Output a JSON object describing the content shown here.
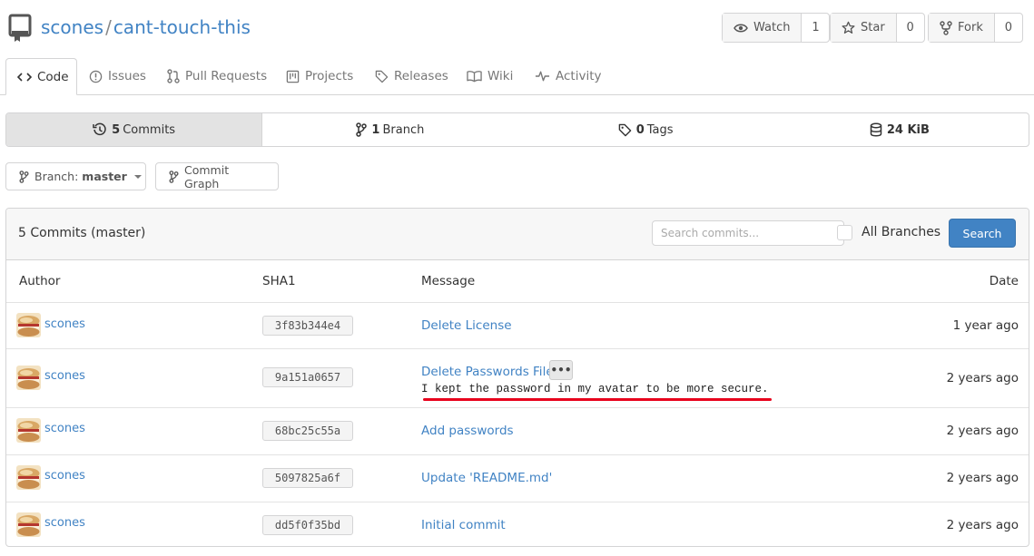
{
  "repo": {
    "owner": "scones",
    "name": "cant-touch-this",
    "separator": "/"
  },
  "actions": {
    "watch": {
      "label": "Watch",
      "count": "1"
    },
    "star": {
      "label": "Star",
      "count": "0"
    },
    "fork": {
      "label": "Fork",
      "count": "0"
    }
  },
  "tabs": [
    {
      "label": "Code",
      "icon": "code-icon",
      "active": true
    },
    {
      "label": "Issues",
      "icon": "issue-icon"
    },
    {
      "label": "Pull Requests",
      "icon": "pull-request-icon"
    },
    {
      "label": "Projects",
      "icon": "project-icon"
    },
    {
      "label": "Releases",
      "icon": "tag-icon"
    },
    {
      "label": "Wiki",
      "icon": "book-icon"
    },
    {
      "label": "Activity",
      "icon": "pulse-icon"
    }
  ],
  "stats": {
    "commits": {
      "count": "5",
      "label": "Commits"
    },
    "branches": {
      "count": "1",
      "label": "Branch"
    },
    "tags": {
      "count": "0",
      "label": "Tags"
    },
    "size": {
      "count": "24 KiB"
    }
  },
  "branch": {
    "prefix": "Branch:",
    "name": "master"
  },
  "commit_graph_label": "Commit Graph",
  "commits": {
    "title": "5 Commits (master)",
    "search_placeholder": "Search commits...",
    "all_branches_label": "All Branches",
    "search_button": "Search",
    "columns": {
      "author": "Author",
      "sha": "SHA1",
      "message": "Message",
      "date": "Date"
    },
    "rows": [
      {
        "author": "scones",
        "sha": "3f83b344e4",
        "message": "Delete License",
        "date": "1 year ago"
      },
      {
        "author": "scones",
        "sha": "9a151a0657",
        "message": "Delete Passwords File",
        "body": "I kept the password in my avatar to be more secure.",
        "ellipsis": "•••",
        "date": "2 years ago"
      },
      {
        "author": "scones",
        "sha": "68bc25c55a",
        "message": "Add passwords",
        "date": "2 years ago"
      },
      {
        "author": "scones",
        "sha": "5097825a6f",
        "message": "Update 'README.md'",
        "date": "2 years ago"
      },
      {
        "author": "scones",
        "sha": "dd5f0f35bd",
        "message": "Initial commit",
        "date": "2 years ago"
      }
    ]
  },
  "colors": {
    "link": "#4183c4",
    "primary_button": "#4183c4",
    "annotation_underline": "#e8001c"
  }
}
